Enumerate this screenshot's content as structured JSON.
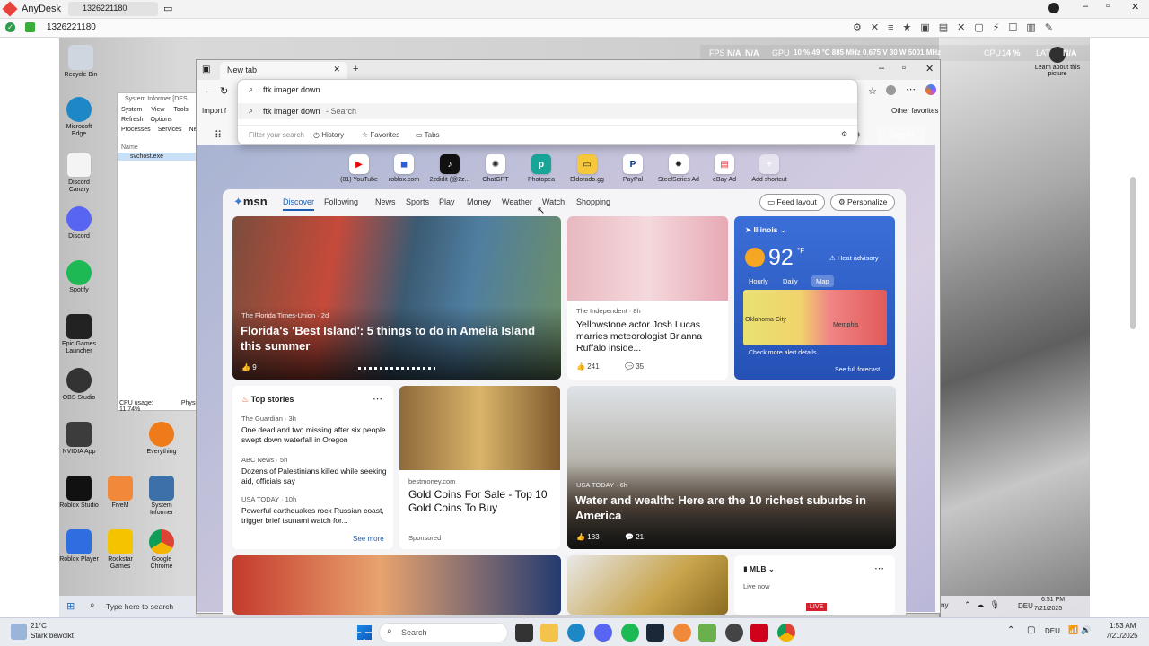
{
  "anydesk": {
    "app": "AnyDesk",
    "session": "1326221180",
    "address": "1326221180"
  },
  "osd": {
    "fps": "FPS",
    "fps_val": "N/A",
    "fps_val2": "N/A",
    "gpu": "GPU",
    "gpu_val": "10 % 49 °C 885 MHz 0.675 V 30 W 5001 MHz",
    "cpu": "CPU",
    "cpu_val": "14 %",
    "lat": "LAT",
    "lat_val": "N/A"
  },
  "desktop": {
    "icons": [
      "Recycle Bin",
      "Microsoft Edge",
      "Discord Canary",
      "Discord",
      "Spotify",
      "Epic Games Launcher",
      "OBS Studio",
      "NVIDIA App",
      "Roblox Studio",
      "Roblox Player",
      "FiveM",
      "Rockstar Games",
      "Google Chrome",
      "System Informer",
      "Everything"
    ],
    "learn_about": "Learn about this picture"
  },
  "sysinfo": {
    "title": "System Informer [DES",
    "menu": [
      "System",
      "View",
      "Tools"
    ],
    "refresh": "Refresh",
    "options": "Options",
    "tabs": [
      "Processes",
      "Services",
      "Net"
    ],
    "col_name": "Name",
    "proc": "svchost.exe",
    "cpu": "CPU usage: 11.74%",
    "phys": "Physi"
  },
  "browser": {
    "tab_title": "New tab",
    "import": "Import f",
    "other_fav": "Other favorites",
    "sign_in": "Sign in",
    "omnibox": {
      "query": "ftk imager down",
      "suggest": "ftk imager down",
      "suggest_suffix": " - Search",
      "filter_placeholder": "Filter your search",
      "history": "History",
      "favorites": "Favorites",
      "tabs": "Tabs"
    },
    "shortcuts": [
      "(81) YouTube",
      "roblox.com",
      "2zdidit (@2z...",
      "ChatGPT",
      "Photopea",
      "Eldorado.gg",
      "PayPal",
      "SteelSeries Ad",
      "eBay Ad",
      "Add shortcut"
    ]
  },
  "msn": {
    "logo": "msn",
    "nav": [
      "Discover",
      "Following",
      "News",
      "Sports",
      "Play",
      "Money",
      "Weather",
      "Watch",
      "Shopping"
    ],
    "feed_layout": "Feed layout",
    "personalize": "Personalize",
    "hero": {
      "source": "The Florida Times-Union · 2d",
      "title": "Florida's 'Best Island': 5 things to do in Amelia Island this summer",
      "likes": "9"
    },
    "card2": {
      "source": "The Independent · 8h",
      "title": "Yellowstone actor Josh Lucas marries meteorologist Brianna Ruffalo inside...",
      "likes": "241",
      "comments": "35"
    },
    "weather": {
      "location": "Illinois",
      "temp": "92",
      "unit": "°F",
      "advisory": "Heat advisory",
      "tabs": [
        "Hourly",
        "Daily",
        "Map"
      ],
      "city": "Oklahoma City",
      "city2": "Memphis",
      "alerts": "Check more alert details",
      "forecast": "See full forecast"
    },
    "top": {
      "title": "Top stories",
      "items": [
        {
          "source": "The Guardian · 3h",
          "title": "One dead and two missing after six people swept down waterfall in Oregon"
        },
        {
          "source": "ABC News · 5h",
          "title": "Dozens of Palestinians killed while seeking aid, officials say"
        },
        {
          "source": "USA TODAY · 10h",
          "title": "Powerful earthquakes rock Russian coast, trigger brief tsunami watch for..."
        }
      ],
      "see_more": "See more"
    },
    "ad": {
      "source": "bestmoney.com",
      "title": "Gold Coins For Sale - Top 10 Gold Coins To Buy",
      "sponsored": "Sponsored"
    },
    "big": {
      "source": "USA TODAY · 6h",
      "title": "Water and wealth: Here are the 10 richest suburbs in America",
      "likes": "183",
      "comments": "21"
    },
    "mlb": {
      "title": "MLB",
      "live": "Live now",
      "badge": "LIVE"
    }
  },
  "taskbar": {
    "temp": "21°C",
    "weather": "Stark bewölkt",
    "search_left": "Type here to search",
    "search_center": "Search",
    "lang": "DEU",
    "time_in": "6:51 PM",
    "date_in": "7/21/2025",
    "time": "1:53 AM",
    "date": "7/21/2025",
    "remote_lang": "DEU",
    "remote_clock": "ny"
  }
}
